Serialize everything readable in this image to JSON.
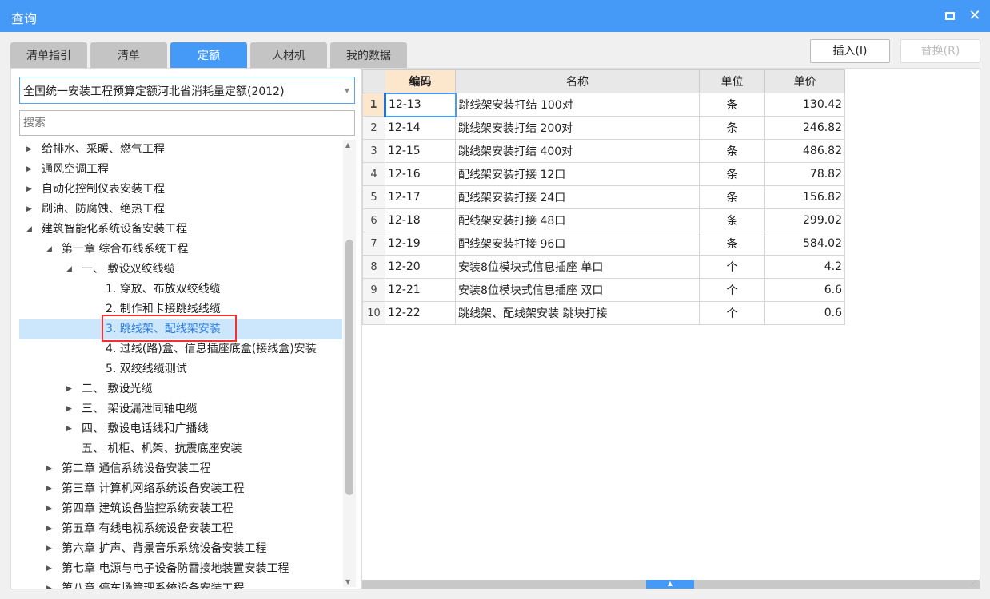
{
  "window": {
    "title": "查询"
  },
  "tabs": [
    {
      "label": "清单指引"
    },
    {
      "label": "清单"
    },
    {
      "label": "定额",
      "active": true
    },
    {
      "label": "人材机"
    },
    {
      "label": "我的数据"
    }
  ],
  "buttons": {
    "insert": "插入(I)",
    "replace": "替换(R)"
  },
  "library_select": {
    "value": "全国统一安装工程预算定额河北省消耗量定额(2012)"
  },
  "search": {
    "placeholder": "搜索"
  },
  "tree": [
    {
      "label": "给排水、采暖、燃气工程",
      "level": 0,
      "state": "collapsed"
    },
    {
      "label": "通风空调工程",
      "level": 0,
      "state": "collapsed"
    },
    {
      "label": "自动化控制仪表安装工程",
      "level": 0,
      "state": "collapsed"
    },
    {
      "label": "刷油、防腐蚀、绝热工程",
      "level": 0,
      "state": "collapsed"
    },
    {
      "label": "建筑智能化系统设备安装工程",
      "level": 0,
      "state": "expanded"
    },
    {
      "label": "第一章 综合布线系统工程",
      "level": 1,
      "state": "expanded"
    },
    {
      "label": "一、 敷设双绞线缆",
      "level": 2,
      "state": "expanded"
    },
    {
      "label": "1. 穿放、布放双绞线缆",
      "level": 3
    },
    {
      "label": "2. 制作和卡接跳线线缆",
      "level": 3
    },
    {
      "label": "3. 跳线架、配线架安装",
      "level": 3,
      "selected": true
    },
    {
      "label": "4. 过线(路)盒、信息插座底盒(接线盒)安装",
      "level": 3
    },
    {
      "label": "5. 双绞线缆测试",
      "level": 3
    },
    {
      "label": "二、 敷设光缆",
      "level": 2,
      "state": "collapsed"
    },
    {
      "label": "三、 架设漏泄同轴电缆",
      "level": 2,
      "state": "collapsed"
    },
    {
      "label": "四、 敷设电话线和广播线",
      "level": 2,
      "state": "collapsed"
    },
    {
      "label": "五、 机柜、机架、抗震底座安装",
      "level": 2
    },
    {
      "label": "第二章 通信系统设备安装工程",
      "level": 1,
      "state": "collapsed"
    },
    {
      "label": "第三章 计算机网络系统设备安装工程",
      "level": 1,
      "state": "collapsed"
    },
    {
      "label": "第四章 建筑设备监控系统安装工程",
      "level": 1,
      "state": "collapsed"
    },
    {
      "label": "第五章 有线电视系统设备安装工程",
      "level": 1,
      "state": "collapsed"
    },
    {
      "label": "第六章 扩声、背景音乐系统设备安装工程",
      "level": 1,
      "state": "collapsed"
    },
    {
      "label": "第七章 电源与电子设备防雷接地装置安装工程",
      "level": 1,
      "state": "collapsed"
    },
    {
      "label": "第八章 停车场管理系统设备安装工程",
      "level": 1,
      "state": "collapsed"
    }
  ],
  "table": {
    "headers": [
      "编码",
      "名称",
      "单位",
      "单价"
    ],
    "rows": [
      {
        "n": "1",
        "code": "12-13",
        "name": "跳线架安装打结 100对",
        "unit": "条",
        "price": "130.42"
      },
      {
        "n": "2",
        "code": "12-14",
        "name": "跳线架安装打结 200对",
        "unit": "条",
        "price": "246.82"
      },
      {
        "n": "3",
        "code": "12-15",
        "name": "跳线架安装打结 400对",
        "unit": "条",
        "price": "486.82"
      },
      {
        "n": "4",
        "code": "12-16",
        "name": "配线架安装打接 12口",
        "unit": "条",
        "price": "78.82"
      },
      {
        "n": "5",
        "code": "12-17",
        "name": "配线架安装打接 24口",
        "unit": "条",
        "price": "156.82"
      },
      {
        "n": "6",
        "code": "12-18",
        "name": "配线架安装打接 48口",
        "unit": "条",
        "price": "299.02"
      },
      {
        "n": "7",
        "code": "12-19",
        "name": "配线架安装打接 96口",
        "unit": "条",
        "price": "584.02"
      },
      {
        "n": "8",
        "code": "12-20",
        "name": "安装8位模块式信息插座 单口",
        "unit": "个",
        "price": "4.2"
      },
      {
        "n": "9",
        "code": "12-21",
        "name": "安装8位模块式信息插座 双口",
        "unit": "个",
        "price": "6.6"
      },
      {
        "n": "10",
        "code": "12-22",
        "name": "跳线架、配线架安装 跳块打接",
        "unit": "个",
        "price": "0.6"
      }
    ]
  },
  "colors": {
    "accent": "#4599f7",
    "selection": "#cce6fb",
    "highlight_box": "#f23030",
    "header_active": "#fde7cc"
  }
}
